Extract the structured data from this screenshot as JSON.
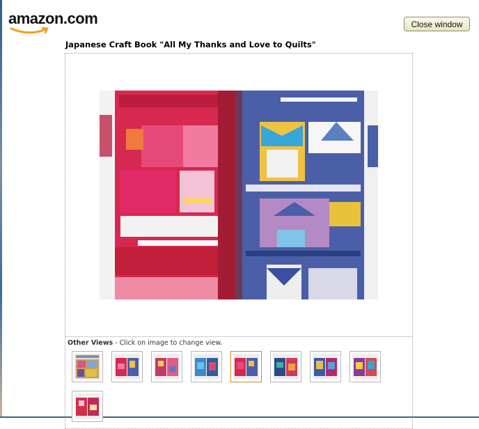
{
  "header": {
    "logo_text": "amazon.com",
    "close_label": "Close window"
  },
  "product": {
    "title": "Japanese Craft Book \"All My Thanks and Love to Quilts\""
  },
  "other_views": {
    "heading": "Other Views",
    "instruction": " - Click on image to change view.",
    "selected_index": 4,
    "thumbnails": [
      {
        "icon": "quilt-cover-thumbnail"
      },
      {
        "icon": "quilt-page-thumbnail"
      },
      {
        "icon": "quilt-page-thumbnail"
      },
      {
        "icon": "quilt-page-thumbnail"
      },
      {
        "icon": "quilt-page-thumbnail"
      },
      {
        "icon": "quilt-page-thumbnail"
      },
      {
        "icon": "quilt-page-thumbnail"
      },
      {
        "icon": "quilt-page-thumbnail"
      },
      {
        "icon": "quilt-page-thumbnail"
      }
    ]
  },
  "colors": {
    "accent": "#d18b17",
    "logo_smile": "#f29d20"
  }
}
